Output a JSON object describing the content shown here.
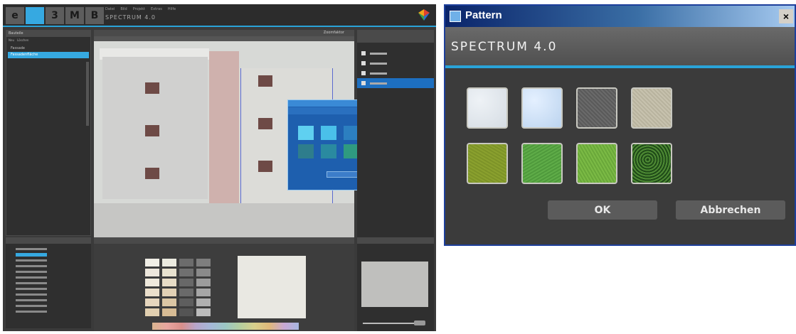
{
  "left_app": {
    "logo_letters": [
      "e",
      "",
      "3",
      "M",
      "B"
    ],
    "menu_items": [
      "Datei",
      "Bild",
      "Projekt",
      "Extras",
      "Hilfe"
    ],
    "app_title": "SPECTRUM 4.0",
    "left_panel": {
      "title": "Bauteile",
      "toolbar": [
        "Neu",
        "Löschen"
      ],
      "tree": [
        "Fassade",
        "Fassadenfläche"
      ]
    },
    "view": {
      "zoom_label": "Zoomfaktor"
    },
    "colors": {
      "accent": "#36a9e1",
      "dialog_blue": "#1e5fae"
    },
    "small_dialog_swatches": [
      "#5fd0f0",
      "#4ac0ea",
      "#2c7fc0",
      "#3aa0c8",
      "#2e7d8c",
      "#2a8aa0",
      "#2f9a80",
      "#2e6e8a"
    ],
    "palette": [
      "#f1efe6",
      "#ecebe0",
      "#6c6c6c",
      "#7e7e7e",
      "#ede7dc",
      "#e8e2cf",
      "#707070",
      "#8a8a8a",
      "#efe9dc",
      "#e7dcc6",
      "#686868",
      "#9c9c9c",
      "#ebdfcb",
      "#e2d1b5",
      "#6a6a6a",
      "#a6a6a6",
      "#e6d6bd",
      "#dbc6a4",
      "#5e5e5e",
      "#b0b0b0",
      "#e1cfb0",
      "#d6bb94",
      "#545454",
      "#bcbcbc"
    ]
  },
  "pattern_dialog": {
    "title": "Pattern",
    "close_glyph": "×",
    "heading": "SPECTRUM 4.0",
    "swatches": [
      "light-grey-plaster",
      "light-blue-plaster",
      "dark-grey-stone",
      "beige-sand",
      "moss-green",
      "grass-green",
      "lime-green",
      "dark-foliage"
    ],
    "ok_label": "OK",
    "cancel_label": "Abbrechen",
    "colors": {
      "title_bar": "#0a246a",
      "accent_line": "#2aa3d8",
      "body": "#3b3b3b"
    }
  }
}
